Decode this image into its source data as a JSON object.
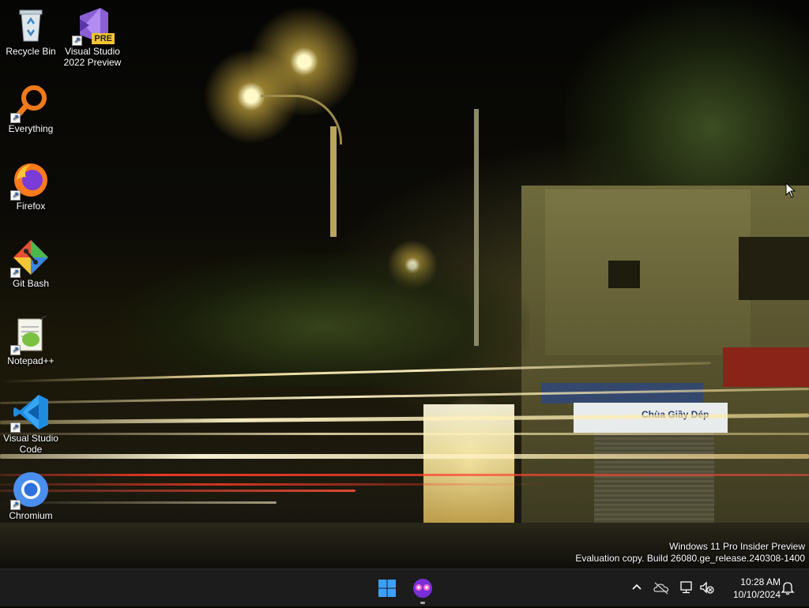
{
  "desktop": {
    "icons": [
      {
        "name": "recycle-bin",
        "label": "Recycle Bin"
      },
      {
        "name": "visual-studio-2022-preview",
        "label": "Visual Studio 2022 Preview",
        "badge": "PRE"
      },
      {
        "name": "everything",
        "label": "Everything"
      },
      {
        "name": "firefox",
        "label": "Firefox"
      },
      {
        "name": "git-bash",
        "label": "Git Bash"
      },
      {
        "name": "notepad-plus-plus",
        "label": "Notepad++"
      },
      {
        "name": "visual-studio-code",
        "label": "Visual Studio Code"
      },
      {
        "name": "chromium",
        "label": "Chromium"
      }
    ],
    "wallpaper_sign_text": "Chùa Giầy Dép",
    "watermark": {
      "line1": "Windows 11 Pro Insider Preview",
      "line2": "Evaluation copy. Build 26080.ge_release.240308-1400"
    }
  },
  "taskbar": {
    "start_icon": "windows-start-icon",
    "pinned": [
      {
        "name": "copilot-icon",
        "running": true
      }
    ],
    "tray": {
      "icons": [
        "chevron-up-icon",
        "onedrive-icon",
        "network-icon",
        "volume-muted-icon"
      ],
      "time": "10:28 AM",
      "date": "10/10/2024",
      "notification_icon": "bell-icon"
    },
    "colors": {
      "background": "#1c1c1c",
      "start_blue": "#3aa0ff"
    }
  }
}
